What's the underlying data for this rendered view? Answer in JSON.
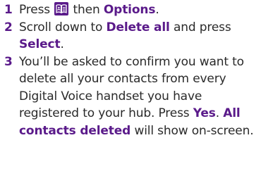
{
  "steps": [
    {
      "number": "1",
      "press": "Press",
      "icon": "phonebook-icon",
      "then": "then",
      "options": "Options",
      "end": "."
    },
    {
      "number": "2",
      "scroll": "Scroll down to",
      "delete_all": "Delete all",
      "and_press": "and press",
      "select": "Select",
      "end": "."
    },
    {
      "number": "3",
      "text": "You’ll be asked to confirm you want to delete all your contacts from every Digital Voice handset you have registered to your hub. Press",
      "yes": "Yes",
      "end": ".",
      "all_deleted": "All contacts deleted",
      "tail": "will show on-screen."
    }
  ],
  "colors": {
    "accent": "#5a1a8a",
    "text": "#2a2a2a"
  }
}
